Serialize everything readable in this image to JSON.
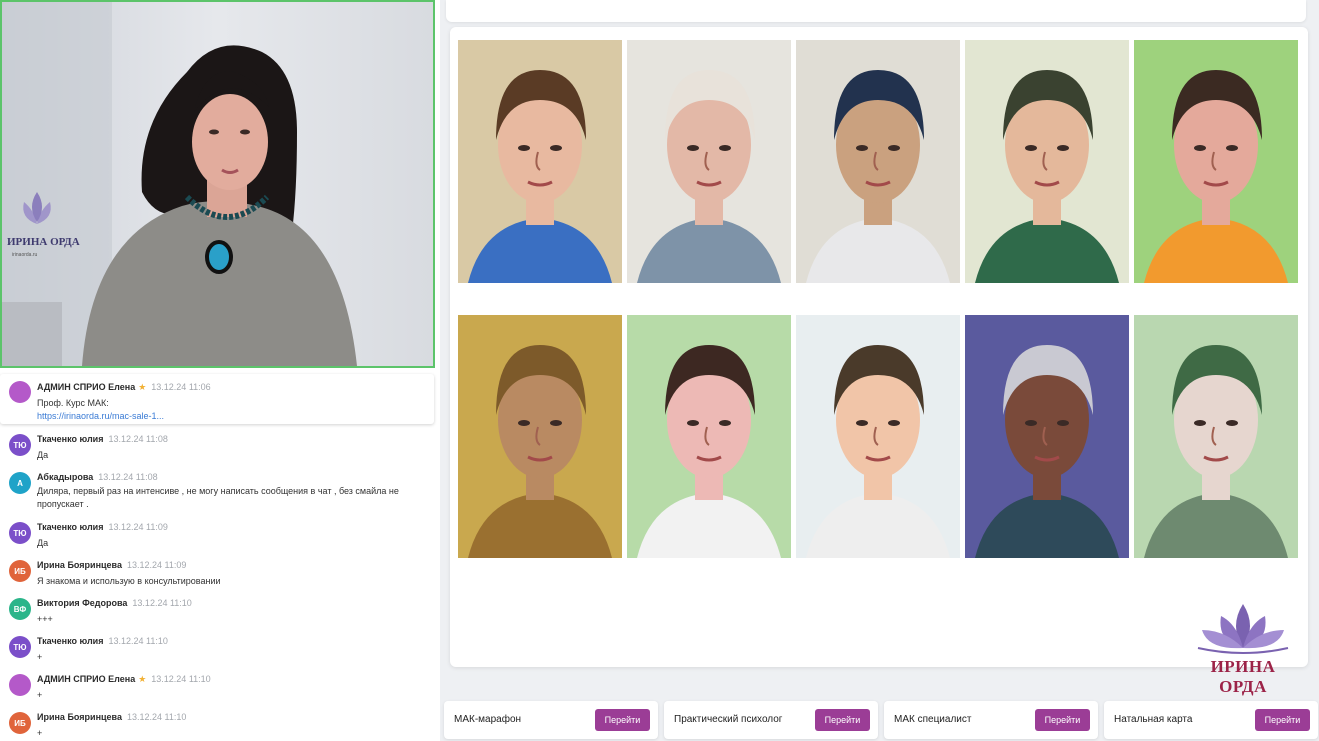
{
  "video": {
    "logo_text": "ИРИНА ОРДА",
    "logo_sub": "irinaorda.ru"
  },
  "chat": {
    "messages": [
      {
        "initials": "",
        "avatar_color": "#b459c9",
        "author": "АДМИН СПРИО Елена",
        "star": "★",
        "time": "13.12.24 11:06",
        "text": "Проф. Курс МАК:",
        "link": "https://irinaorda.ru/mac-sale-1..."
      },
      {
        "initials": "ТЮ",
        "avatar_color": "#7b4fc9",
        "author": "Ткаченко юлия",
        "time": "13.12.24 11:08",
        "text": "Да"
      },
      {
        "initials": "А",
        "avatar_color": "#1fa3c8",
        "author": "Абкадырова",
        "time": "13.12.24 11:08",
        "text": "Диляра, первый раз на интенсиве , не могу написать сообщения в чат , без смайла не пропускает ."
      },
      {
        "initials": "ТЮ",
        "avatar_color": "#7b4fc9",
        "author": "Ткаченко юлия",
        "time": "13.12.24 11:09",
        "text": "Да"
      },
      {
        "initials": "ИБ",
        "avatar_color": "#e0643b",
        "author": "Ирина Бояринцева",
        "time": "13.12.24 11:09",
        "text": "Я знакома и использую в консультировании"
      },
      {
        "initials": "ВФ",
        "avatar_color": "#2bb58a",
        "author": "Виктория Федорова",
        "time": "13.12.24 11:10",
        "text": "+++"
      },
      {
        "initials": "ТЮ",
        "avatar_color": "#7b4fc9",
        "author": "Ткаченко юлия",
        "time": "13.12.24 11:10",
        "text": "+"
      },
      {
        "initials": "",
        "avatar_color": "#b459c9",
        "author": "АДМИН СПРИО Елена",
        "star": "★",
        "time": "13.12.24 11:10",
        "text": "+"
      },
      {
        "initials": "ИБ",
        "avatar_color": "#e0643b",
        "author": "Ирина Бояринцева",
        "time": "13.12.24 11:10",
        "text": "+"
      }
    ]
  },
  "slide": {
    "brand_name": "ИРИНА ОРДА",
    "cards": [
      {
        "bg": "#d9c9a5",
        "skin": "#e8b9a0",
        "hair": "#5a3b25",
        "cloth": "#3a6fc2"
      },
      {
        "bg": "#e6e4de",
        "skin": "#e3b8a7",
        "hair": "#e8e2da",
        "cloth": "#7e93a8"
      },
      {
        "bg": "#e0ddd5",
        "skin": "#caa17f",
        "hair": "#22324e",
        "cloth": "#e8e8ea"
      },
      {
        "bg": "#e2e6d2",
        "skin": "#e4b89b",
        "hair": "#3a4230",
        "cloth": "#2f6a4a"
      },
      {
        "bg": "#9ed27d",
        "skin": "#e4a99b",
        "hair": "#3b2a22",
        "cloth": "#f29a2e"
      },
      {
        "bg": "#c9a84e",
        "skin": "#b98a62",
        "hair": "#7d5a2a",
        "cloth": "#9a7030"
      },
      {
        "bg": "#b7dba8",
        "skin": "#edb9b5",
        "hair": "#3d2822",
        "cloth": "#f2f2f2"
      },
      {
        "bg": "#e8eef0",
        "skin": "#f1c5a8",
        "hair": "#4a3a2a",
        "cloth": "#eeeeee"
      },
      {
        "bg": "#5a5a9e",
        "skin": "#7a4a3a",
        "hair": "#c9c9d2",
        "cloth": "#2e4a5a"
      },
      {
        "bg": "#b9d7b0",
        "skin": "#e6d6cf",
        "hair": "#3f6a45",
        "cloth": "#6e8a70"
      }
    ]
  },
  "courses": [
    {
      "label": "МАК-марафон",
      "button": "Перейти"
    },
    {
      "label": "Практический психолог",
      "button": "Перейти"
    },
    {
      "label": "МАК специалист",
      "button": "Перейти"
    },
    {
      "label": "Натальная карта",
      "button": "Перейти"
    }
  ]
}
